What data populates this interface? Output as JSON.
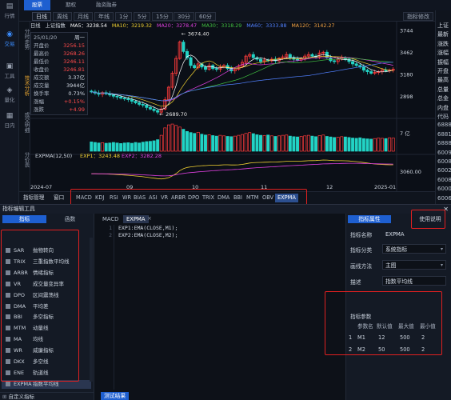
{
  "top_tabs": [
    "股票",
    "期权",
    "融资融券"
  ],
  "left_nav": [
    {
      "icon": "quote-icon",
      "label": "行情"
    },
    {
      "icon": "trade-icon",
      "label": "交易"
    },
    {
      "icon": "tools-icon",
      "label": "工具"
    },
    {
      "icon": "quant-icon",
      "label": "量化"
    },
    {
      "icon": "news-icon",
      "label": "日内"
    }
  ],
  "period_tabs": [
    "日线",
    "周线",
    "月线",
    "年线",
    "1分",
    "5分",
    "15分",
    "30分",
    "60分"
  ],
  "period_right_label": "指标修改",
  "side_tabs": [
    "分时走势",
    "技术分析",
    "成交明细",
    "分价表"
  ],
  "ma_bar": {
    "prefix": "日线",
    "name": "上证指数",
    "items": [
      {
        "label": "MA5：3238.54",
        "color": "#ffffff"
      },
      {
        "label": "MA10：3219.32",
        "color": "#f0d030"
      },
      {
        "label": "MA20：3278.47",
        "color": "#e040e0"
      },
      {
        "label": "MA30：3318.29",
        "color": "#40c040"
      },
      {
        "label": "MA60：3333.88",
        "color": "#5080ff"
      },
      {
        "label": "MA120：3142.27",
        "color": "#f0a040"
      }
    ]
  },
  "info_box": {
    "date": "25/01/20",
    "weekday": "周一",
    "rows": [
      {
        "k": "开盘价",
        "v": "3256.15",
        "color": "#ff4a4a"
      },
      {
        "k": "最高价",
        "v": "3268.26",
        "color": "#ff4a4a"
      },
      {
        "k": "最低价",
        "v": "3246.11",
        "color": "#ff4a4a"
      },
      {
        "k": "收盘价",
        "v": "3246.81",
        "color": "#ff4a4a"
      },
      {
        "k": "成交额",
        "v": "3.37亿",
        "color": "#d6dde8"
      },
      {
        "k": "成交量",
        "v": "3944亿",
        "color": "#d6dde8"
      },
      {
        "k": "换手率",
        "v": "0.73%",
        "color": "#d6dde8"
      },
      {
        "k": "涨幅",
        "v": "+0.15%",
        "color": "#ff4a4a"
      },
      {
        "k": "涨跌",
        "v": "+4.99",
        "color": "#ff4a4a"
      }
    ]
  },
  "chart_data": {
    "type": "candlestick",
    "price_axis": [
      "3744",
      "3462",
      "3180",
      "2898"
    ],
    "high_label": "3674.40",
    "low_label": "2689.70",
    "volume_axis": "7 亿",
    "indicator_title": "EXPMA(12,50)",
    "indicator_values": [
      {
        "label": "EXP1：3243.48",
        "color": "#f0d030"
      },
      {
        "label": "EXP2：3282.28",
        "color": "#e040e0"
      }
    ],
    "indicator_axis": "3060.00",
    "x_labels": [
      "2024-07",
      "09",
      "10",
      "11",
      "12",
      "2025-01"
    ],
    "closes": [
      2960,
      2945,
      2930,
      2950,
      2935,
      2920,
      2905,
      2895,
      2880,
      2870,
      2860,
      2840,
      2820,
      2800,
      2790,
      2760,
      2740,
      2720,
      2700,
      2740,
      2860,
      3020,
      3200,
      3390,
      3600,
      3480,
      3400,
      3300,
      3270,
      3320,
      3280,
      3250,
      3300,
      3260,
      3250,
      3280,
      3300,
      3260,
      3230,
      3250,
      3290,
      3340,
      3420,
      3440,
      3400,
      3380,
      3350,
      3370,
      3360,
      3380,
      3360,
      3390,
      3410,
      3440,
      3400,
      3380,
      3370,
      3390,
      3420,
      3440,
      3420,
      3410,
      3460,
      3470,
      3400,
      3360,
      3350,
      3380,
      3400,
      3380,
      3350,
      3320,
      3300,
      3280,
      3240,
      3220,
      3200,
      3210,
      3220,
      3240,
      3230,
      3240,
      3250
    ],
    "volumes": [
      3.4,
      3.2,
      3.0,
      3.1,
      2.9,
      3.0,
      3.2,
      3.0,
      2.8,
      3.0,
      3.1,
      2.9,
      3.2,
      3.0,
      3.3,
      3.5,
      3.6,
      3.8,
      4.2,
      5.8,
      8.5,
      9.6,
      9.9,
      9.4,
      8.8,
      8.0,
      7.2,
      6.8,
      6.5,
      6.9,
      6.2,
      5.9,
      6.0,
      5.7,
      5.5,
      5.8,
      5.6,
      5.4,
      5.3,
      5.5,
      5.8,
      6.1,
      6.5,
      6.8,
      6.4,
      6.0,
      5.8,
      5.7,
      5.9,
      5.6,
      5.4,
      5.6,
      5.8,
      5.9,
      5.5,
      5.3,
      5.2,
      5.4,
      5.6,
      5.8,
      5.5,
      5.3,
      5.7,
      5.9,
      5.4,
      5.2,
      5.0,
      5.1,
      5.3,
      5.2,
      5.0,
      4.8,
      4.7,
      4.9,
      4.6,
      4.5,
      4.4,
      4.6,
      4.8,
      4.7,
      4.6,
      4.9,
      4.8
    ],
    "ma_series": [
      {
        "name": "MA5",
        "color": "#ffffff"
      },
      {
        "name": "MA10",
        "color": "#f0d030"
      },
      {
        "name": "MA20",
        "color": "#e040e0"
      },
      {
        "name": "MA30",
        "color": "#40c040"
      },
      {
        "name": "MA60",
        "color": "#5080ff"
      }
    ]
  },
  "indicator_tabs": [
    "指标管理",
    "窗口",
    "MACD",
    "KDJ",
    "RSI",
    "WR",
    "BIAS",
    "ASI",
    "VR",
    "ARBR",
    "DPO",
    "TRIX",
    "DMA",
    "BBI",
    "MTM",
    "OBV",
    "EXPMA"
  ],
  "indicator_selected": "EXPMA",
  "right_panel": [
    "上证",
    "最新",
    "涨跌",
    "涨幅",
    "振幅",
    "开盘",
    "最高",
    "总量",
    "总金",
    "内盘",
    "代码",
    "6888",
    "6881",
    "6888",
    "6009",
    "6008",
    "6002",
    "6008",
    "6000",
    "6006"
  ],
  "editor": {
    "title": "指标编辑工具",
    "left_tabs": [
      "指标",
      "函数"
    ],
    "list": [
      {
        "abbr": "SAR",
        "name": "抛物转向"
      },
      {
        "abbr": "TRIX",
        "name": "三重指数平均线"
      },
      {
        "abbr": "ARBR",
        "name": "情绪指标"
      },
      {
        "abbr": "VR",
        "name": "成交量变异率"
      },
      {
        "abbr": "DPO",
        "name": "区间震荡线"
      },
      {
        "abbr": "DMA",
        "name": "平均差"
      },
      {
        "abbr": "BBI",
        "name": "多空指标"
      },
      {
        "abbr": "MTM",
        "name": "动量线"
      },
      {
        "abbr": "MA",
        "name": "均线"
      },
      {
        "abbr": "WR",
        "name": "威廉指标"
      },
      {
        "abbr": "DKX",
        "name": "多空线"
      },
      {
        "abbr": "ENE",
        "name": "轨道线"
      },
      {
        "abbr": "EXPMA",
        "name": "指数平均线"
      }
    ],
    "list_footer": "自定义指标",
    "code_tabs": [
      "MACD",
      "EXPMA"
    ],
    "code_lines": [
      {
        "ln": "1",
        "text": "EXP1:EMA(CLOSE,M1);"
      },
      {
        "ln": "2",
        "text": "EXP2:EMA(CLOSE,M2);"
      }
    ],
    "test_button": "测试结果",
    "prop_tabs": [
      "指标属性",
      "使用说明"
    ],
    "props": [
      {
        "k": "指标名称",
        "v": "EXPMA",
        "dropdown": false
      },
      {
        "k": "指标分类",
        "v": "系统指标",
        "dropdown": true
      },
      {
        "k": "画线方法",
        "v": "主图",
        "dropdown": true
      },
      {
        "k": "描述",
        "v": "指数平均线",
        "dropdown": false
      }
    ],
    "params_title": "指标参数",
    "params_header": [
      "参数名",
      "默认值",
      "最大值",
      "最小值"
    ],
    "params": [
      {
        "idx": "1",
        "name": "M1",
        "def": "12",
        "max": "500",
        "min": "2"
      },
      {
        "idx": "2",
        "name": "M2",
        "def": "50",
        "max": "500",
        "min": "2"
      }
    ]
  }
}
